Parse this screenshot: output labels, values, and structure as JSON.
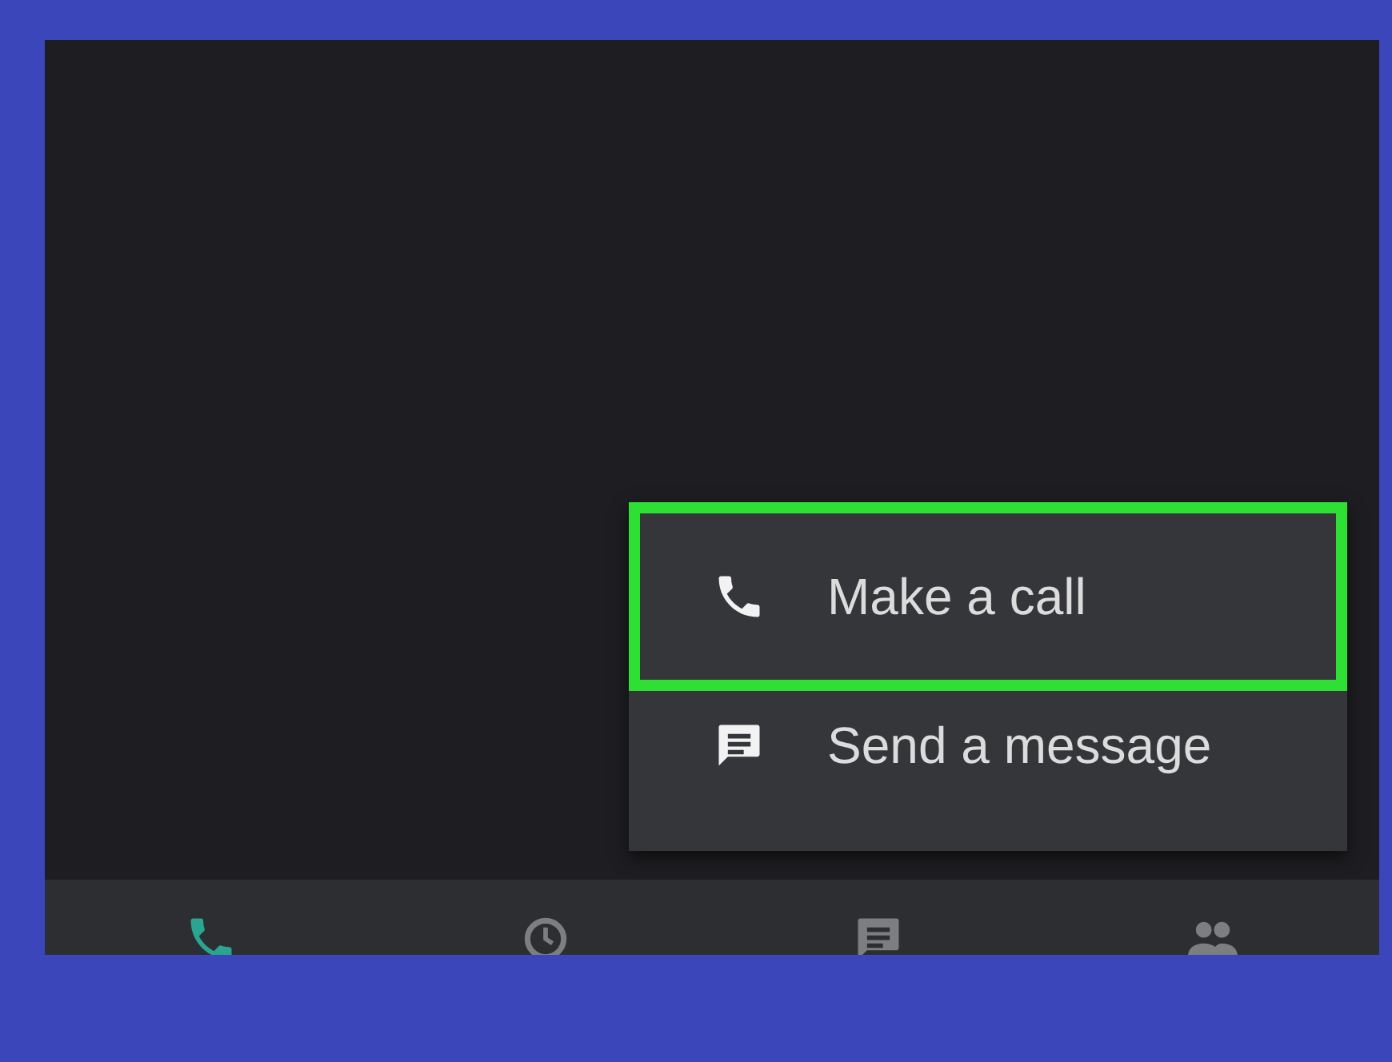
{
  "menu": {
    "items": [
      {
        "kind": "call",
        "label": "Make a call",
        "highlighted": true
      },
      {
        "kind": "message",
        "label": "Send a message",
        "highlighted": false
      }
    ]
  },
  "bottom_nav": {
    "items": [
      {
        "kind": "phone",
        "selected": true
      },
      {
        "kind": "clock",
        "selected": false
      },
      {
        "kind": "message",
        "selected": false
      },
      {
        "kind": "people",
        "selected": false
      }
    ]
  }
}
